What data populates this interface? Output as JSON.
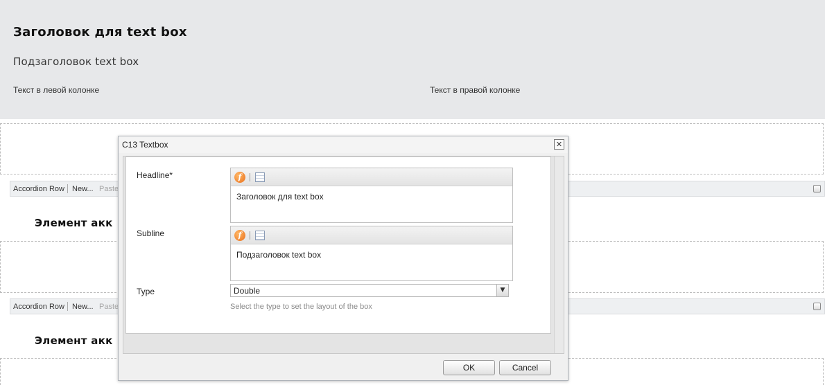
{
  "hero": {
    "title": "Заголовок для text box",
    "subtitle": "Подзаголовок text box",
    "left_column": "Текст в левой колонке",
    "right_column": "Текст в правой колонке"
  },
  "editbars": [
    {
      "accordion_row": "Accordion Row",
      "new": "New...",
      "paste": "Paste"
    },
    {
      "accordion_row": "Accordion Row",
      "new": "New...",
      "paste": "Paste"
    }
  ],
  "accordion_titles": [
    "Элемент акк",
    "Элемент акк"
  ],
  "dialog": {
    "title": "C13 Textbox",
    "close_glyph": "✕",
    "fields": {
      "headline_label": "Headline*",
      "headline_value": "Заголовок для text box",
      "subline_label": "Subline",
      "subline_value": "Подзаголовок text box",
      "type_label": "Type",
      "type_value": "Double",
      "type_hint": "Select the type to set the layout of the box"
    },
    "rte_icons": [
      "format-icon",
      "edit-source-icon"
    ],
    "format_glyph": "f",
    "select_arrow": "▼",
    "ok_label": "OK",
    "cancel_label": "Cancel"
  }
}
